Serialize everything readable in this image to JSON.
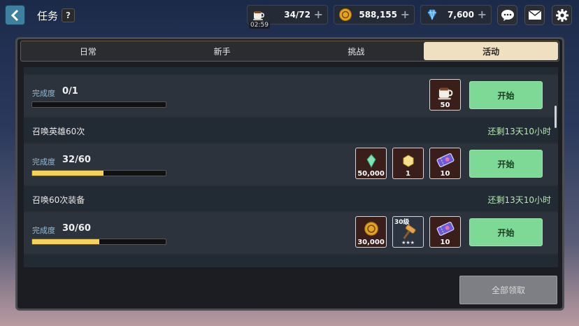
{
  "header": {
    "title": "任务",
    "help_label": "?",
    "resources": [
      {
        "icon": "coffee-cup-icon",
        "value": "34/72",
        "timer": "02:59"
      },
      {
        "icon": "gold-coin-icon",
        "value": "588,155"
      },
      {
        "icon": "diamond-icon",
        "value": "7,600"
      }
    ],
    "plus_label": "+"
  },
  "tabs": [
    {
      "label": "日常",
      "active": false
    },
    {
      "label": "新手",
      "active": false
    },
    {
      "label": "挑战",
      "active": false
    },
    {
      "label": "活动",
      "active": true
    }
  ],
  "quests": [
    {
      "name": "",
      "remain": "",
      "progress_label": "完成度",
      "progress_text": "0/1",
      "progress_fraction": 0,
      "rewards": [
        {
          "icon": "coffee-cup-icon",
          "qty": "50"
        }
      ],
      "button": "开始"
    },
    {
      "name": "召唤英雄60次",
      "remain": "还剩13天10小时",
      "progress_label": "完成度",
      "progress_text": "32/60",
      "progress_fraction": 0.533,
      "rewards": [
        {
          "icon": "green-gem-icon",
          "qty": "50,000"
        },
        {
          "icon": "yellow-gem-icon",
          "qty": "1"
        },
        {
          "icon": "ticket-icon",
          "qty": "10"
        }
      ],
      "button": "开始"
    },
    {
      "name": "召唤60次装备",
      "remain": "还剩13天10小时",
      "progress_label": "完成度",
      "progress_text": "30/60",
      "progress_fraction": 0.5,
      "rewards": [
        {
          "icon": "gold-coin-icon",
          "qty": "30,000"
        },
        {
          "icon": "hammer-icon",
          "qty": "",
          "level": "30级",
          "stars": "★★★"
        },
        {
          "icon": "ticket-icon",
          "qty": "10"
        }
      ],
      "button": "开始"
    }
  ],
  "claim_all": "全部领取",
  "colors": {
    "accent_green": "#7fd996",
    "progress_yellow": "#f6d25a",
    "tab_active": "#efe0c2"
  }
}
